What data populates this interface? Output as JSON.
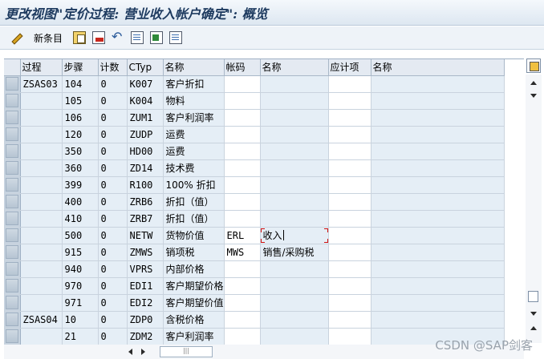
{
  "window": {
    "title": "更改视图\"定价过程: 营业收入帐户确定\": 概览"
  },
  "toolbar": {
    "new_entries_label": "新条目",
    "icons": [
      "pencil-icon",
      "copy-icon",
      "delete-icon",
      "undo-icon",
      "select-all-icon",
      "select-block-icon",
      "deselect-icon"
    ]
  },
  "table": {
    "headers": [
      "过程",
      "步骤",
      "计数",
      "CTyp",
      "名称",
      "帐码",
      "名称",
      "应计项",
      "名称"
    ],
    "rows": [
      {
        "proc": "ZSAS03",
        "step": "104",
        "cnt": "0",
        "ctyp": "K007",
        "name": "客户折扣",
        "acct": "",
        "acct_name": "",
        "accr": "",
        "accr_name": ""
      },
      {
        "proc": "",
        "step": "105",
        "cnt": "0",
        "ctyp": "K004",
        "name": "物料",
        "acct": "",
        "acct_name": "",
        "accr": "",
        "accr_name": ""
      },
      {
        "proc": "",
        "step": "106",
        "cnt": "0",
        "ctyp": "ZUM1",
        "name": "客户利润率",
        "acct": "",
        "acct_name": "",
        "accr": "",
        "accr_name": ""
      },
      {
        "proc": "",
        "step": "120",
        "cnt": "0",
        "ctyp": "ZUDP",
        "name": "运费",
        "acct": "",
        "acct_name": "",
        "accr": "",
        "accr_name": ""
      },
      {
        "proc": "",
        "step": "350",
        "cnt": "0",
        "ctyp": "HD00",
        "name": "运费",
        "acct": "",
        "acct_name": "",
        "accr": "",
        "accr_name": ""
      },
      {
        "proc": "",
        "step": "360",
        "cnt": "0",
        "ctyp": "ZD14",
        "name": "技术费",
        "acct": "",
        "acct_name": "",
        "accr": "",
        "accr_name": ""
      },
      {
        "proc": "",
        "step": "399",
        "cnt": "0",
        "ctyp": "R100",
        "name": "100% 折扣",
        "acct": "",
        "acct_name": "",
        "accr": "",
        "accr_name": ""
      },
      {
        "proc": "",
        "step": "400",
        "cnt": "0",
        "ctyp": "ZRB6",
        "name": "折扣（值）",
        "acct": "",
        "acct_name": "",
        "accr": "",
        "accr_name": ""
      },
      {
        "proc": "",
        "step": "410",
        "cnt": "0",
        "ctyp": "ZRB7",
        "name": "折扣（值）",
        "acct": "",
        "acct_name": "",
        "accr": "",
        "accr_name": ""
      },
      {
        "proc": "",
        "step": "500",
        "cnt": "0",
        "ctyp": "NETW",
        "name": "货物价值",
        "acct": "ERL",
        "acct_name": "收入",
        "accr": "",
        "accr_name": ""
      },
      {
        "proc": "",
        "step": "915",
        "cnt": "0",
        "ctyp": "ZMWS",
        "name": "销项税",
        "acct": "MWS",
        "acct_name": "销售/采购税",
        "accr": "",
        "accr_name": ""
      },
      {
        "proc": "",
        "step": "940",
        "cnt": "0",
        "ctyp": "VPRS",
        "name": "内部价格",
        "acct": "",
        "acct_name": "",
        "accr": "",
        "accr_name": ""
      },
      {
        "proc": "",
        "step": "970",
        "cnt": "0",
        "ctyp": "EDI1",
        "name": "客户期望价格",
        "acct": "",
        "acct_name": "",
        "accr": "",
        "accr_name": ""
      },
      {
        "proc": "",
        "step": "971",
        "cnt": "0",
        "ctyp": "EDI2",
        "name": "客户期望价值",
        "acct": "",
        "acct_name": "",
        "accr": "",
        "accr_name": ""
      },
      {
        "proc": "ZSAS04",
        "step": "10",
        "cnt": "0",
        "ctyp": "ZDP0",
        "name": "含税价格",
        "acct": "",
        "acct_name": "",
        "accr": "",
        "accr_name": ""
      },
      {
        "proc": "",
        "step": "21",
        "cnt": "0",
        "ctyp": "ZDM2",
        "name": "客户利润率",
        "acct": "",
        "acct_name": "",
        "accr": "",
        "accr_name": ""
      }
    ]
  },
  "watermark": "CSDN @SAP剑客",
  "colors": {
    "title_text": "#1d3a5f",
    "row_bg": "#e5eef6",
    "edit_bg": "#ffffff",
    "focus_marker": "#d01010"
  }
}
